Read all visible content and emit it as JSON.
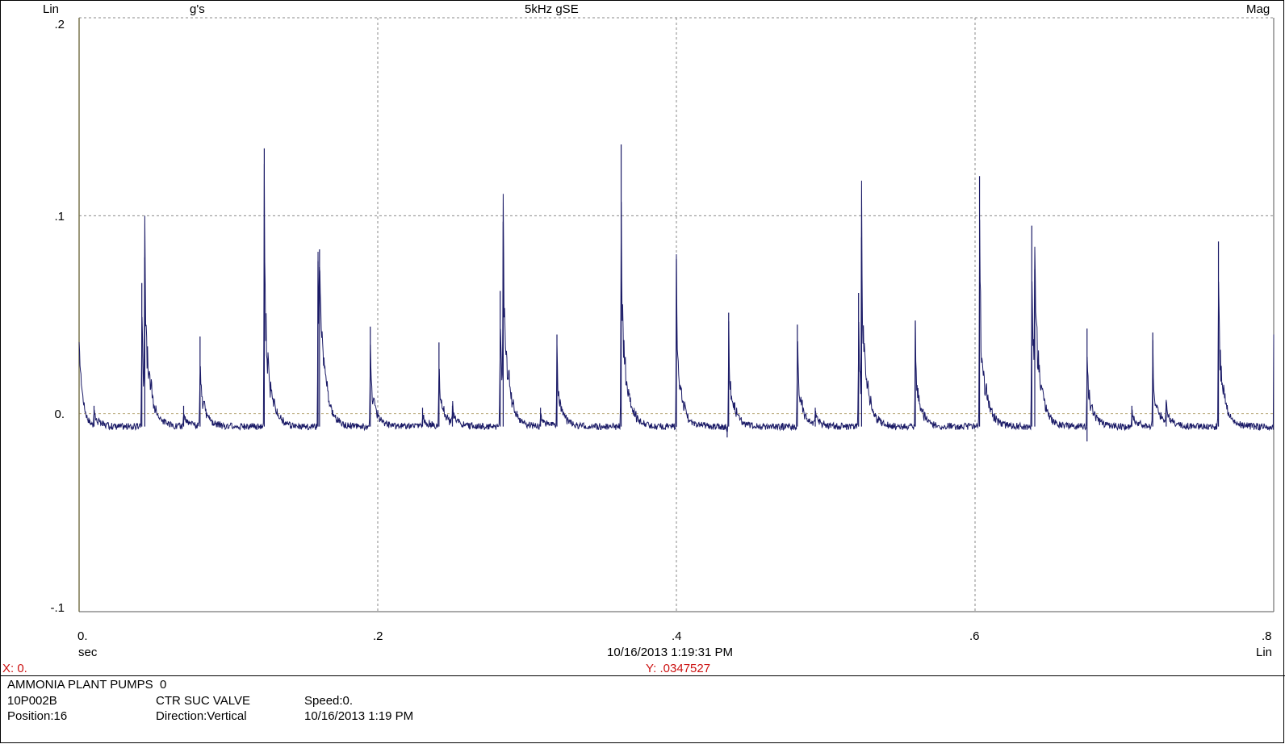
{
  "header": {
    "scale_left": "Lin",
    "units": "g's",
    "title": "5kHz gSE",
    "display_mode": "Mag"
  },
  "x_axis": {
    "unit_label": "sec",
    "scale_label": "Lin",
    "timestamp": "10/16/2013 1:19:31 PM"
  },
  "cursor": {
    "x_readout": "X: 0.",
    "y_readout": "Y: .0347527"
  },
  "info": {
    "plant": "AMMONIA PLANT PUMPS",
    "plant_suffix": "0",
    "machine": "10P002B",
    "position": "Position:16",
    "point": "CTR SUC VALVE",
    "direction": "Direction:Vertical",
    "speed": "Speed:0.",
    "date": "10/16/2013 1:19 PM"
  },
  "colors": {
    "trace": "#1a1a66",
    "grid": "#8a8a8a",
    "zero_line": "#b8a878",
    "cursor_line": "#c8b840",
    "cursor_text": "#cc1111"
  },
  "chart_data": {
    "type": "line",
    "title": "5kHz gSE",
    "ylabel": "g's",
    "xlabel": "sec",
    "xlim": [
      0,
      0.8
    ],
    "ylim": [
      -0.1,
      0.2
    ],
    "x_ticks": [
      0,
      0.2,
      0.4,
      0.6,
      0.8
    ],
    "x_tick_labels": [
      "0.",
      ".2",
      ".4",
      ".6",
      ".8"
    ],
    "y_ticks": [
      0.2,
      0.1,
      0,
      -0.1
    ],
    "y_tick_labels": [
      ".2",
      ".1",
      "0.",
      "-.1"
    ],
    "grid": true,
    "baseline": -0.0065,
    "start_value": 0.0348,
    "end_value": 0.04,
    "peaks": [
      {
        "x": 0.01,
        "y": 0.004
      },
      {
        "x": 0.042,
        "y": 0.066
      },
      {
        "x": 0.044,
        "y": 0.079
      },
      {
        "x": 0.07,
        "y": 0.004
      },
      {
        "x": 0.081,
        "y": 0.039
      },
      {
        "x": 0.124,
        "y": 0.134
      },
      {
        "x": 0.16,
        "y": 0.077
      },
      {
        "x": 0.161,
        "y": 0.083
      },
      {
        "x": 0.195,
        "y": 0.044
      },
      {
        "x": 0.23,
        "y": 0.003
      },
      {
        "x": 0.241,
        "y": 0.036
      },
      {
        "x": 0.25,
        "y": 0.004
      },
      {
        "x": 0.282,
        "y": 0.062
      },
      {
        "x": 0.284,
        "y": 0.097
      },
      {
        "x": 0.309,
        "y": 0.003
      },
      {
        "x": 0.32,
        "y": 0.04
      },
      {
        "x": 0.363,
        "y": 0.136
      },
      {
        "x": 0.4,
        "y": 0.078
      },
      {
        "x": 0.435,
        "y": 0.051
      },
      {
        "x": 0.481,
        "y": 0.045
      },
      {
        "x": 0.493,
        "y": 0.003
      },
      {
        "x": 0.522,
        "y": 0.061
      },
      {
        "x": 0.524,
        "y": 0.089
      },
      {
        "x": 0.56,
        "y": 0.047
      },
      {
        "x": 0.603,
        "y": 0.12
      },
      {
        "x": 0.638,
        "y": 0.095
      },
      {
        "x": 0.64,
        "y": 0.073
      },
      {
        "x": 0.675,
        "y": 0.043
      },
      {
        "x": 0.705,
        "y": 0.004
      },
      {
        "x": 0.719,
        "y": 0.041
      },
      {
        "x": 0.728,
        "y": 0.006
      },
      {
        "x": 0.763,
        "y": 0.087
      }
    ],
    "dips": [
      {
        "x": 0.434,
        "y": -0.012
      },
      {
        "x": 0.675,
        "y": -0.014
      }
    ]
  }
}
